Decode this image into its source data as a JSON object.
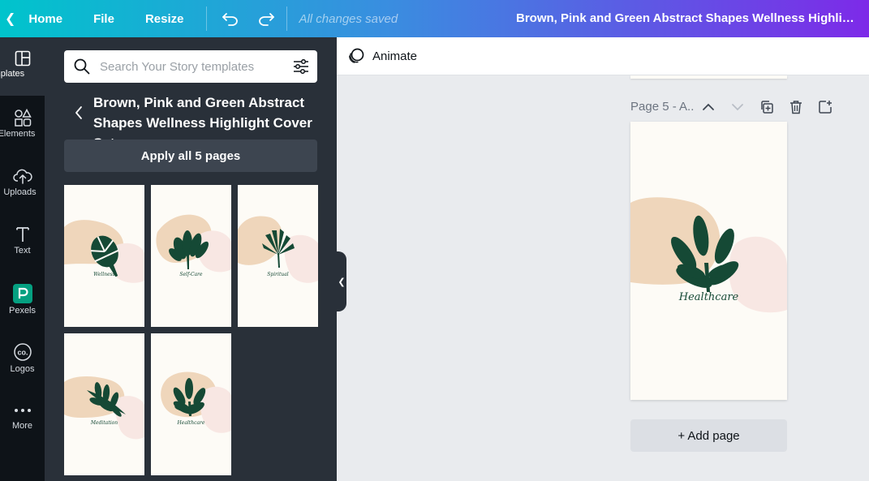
{
  "topbar": {
    "home_label": "Home",
    "file_label": "File",
    "resize_label": "Resize",
    "save_status": "All changes saved",
    "design_title": "Brown, Pink and Green Abstract Shapes Wellness Highlight Cover Set"
  },
  "rail": {
    "items": [
      {
        "label": "Templates",
        "icon": "templates-icon"
      },
      {
        "label": "Elements",
        "icon": "elements-icon"
      },
      {
        "label": "Uploads",
        "icon": "uploads-icon"
      },
      {
        "label": "Text",
        "icon": "text-icon"
      },
      {
        "label": "Pexels",
        "icon": "pexels-icon"
      },
      {
        "label": "Logos",
        "icon": "logos-icon"
      },
      {
        "label": "More",
        "icon": "more-icon"
      }
    ]
  },
  "panel": {
    "search_placeholder": "Search Your Story templates",
    "title": "Brown, Pink and Green Abstract Shapes Wellness Highlight Cover Set",
    "apply_label": "Apply all 5 pages",
    "thumbnails": [
      {
        "caption": "Wellness"
      },
      {
        "caption": "Self-Care"
      },
      {
        "caption": "Spiritual"
      },
      {
        "caption": "Meditation"
      },
      {
        "caption": "Healthcare"
      }
    ]
  },
  "editor": {
    "animate_label": "Animate",
    "page_label": "Page 5 - A..",
    "page_caption": "Healthcare",
    "add_page_label": "+ Add page"
  },
  "colors": {
    "beige": "#efd6bb",
    "pink": "#f8e7e3",
    "leaf": "#154935",
    "paper": "#fdfbf6"
  }
}
